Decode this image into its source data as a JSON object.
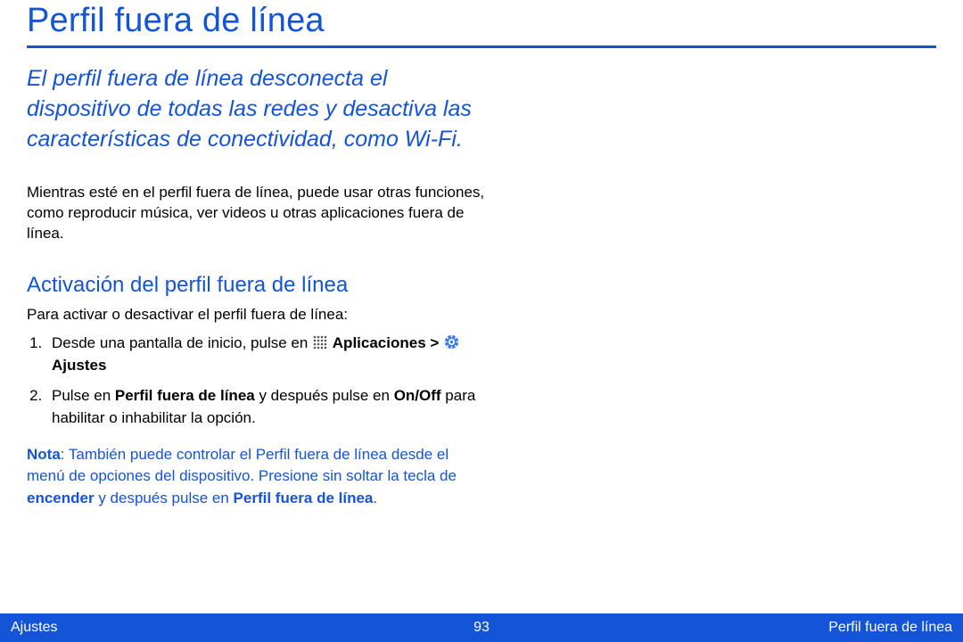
{
  "header": {
    "title": "Perfil fuera de línea"
  },
  "intro": "El perfil fuera de línea desconecta el dispositivo de todas las redes y desactiva las características de conectividad, como Wi-Fi.",
  "body1": "Mientras esté en el perfil fuera de línea, puede usar otras funciones, como reproducir música, ver videos u otras aplicaciones fuera de línea.",
  "section": {
    "title": "Activación del perfil fuera de línea",
    "lead": "Para activar o desactivar el perfil fuera de línea:",
    "steps": {
      "one_prefix": "Desde una pantalla de inicio, pulse en ",
      "apps_label": "Aplicaciones",
      "gt": " > ",
      "settings_label": "Ajustes",
      "two_a": "Pulse en ",
      "two_b": "Perfil fuera de línea",
      "two_c": " y después pulse en ",
      "two_d": "On/Off",
      "two_e": " para habilitar o inhabilitar la opción."
    }
  },
  "note": {
    "label": "Nota",
    "a": ": También puede controlar el Perfil fuera de línea desde el menú de opciones del dispositivo. Presione sin soltar la tecla de ",
    "b": "encender",
    "c": " y después pulse en ",
    "d": "Perfil fuera de línea",
    "e": "."
  },
  "footer": {
    "left": "Ajustes",
    "page": "93",
    "right": "Perfil fuera de línea"
  }
}
